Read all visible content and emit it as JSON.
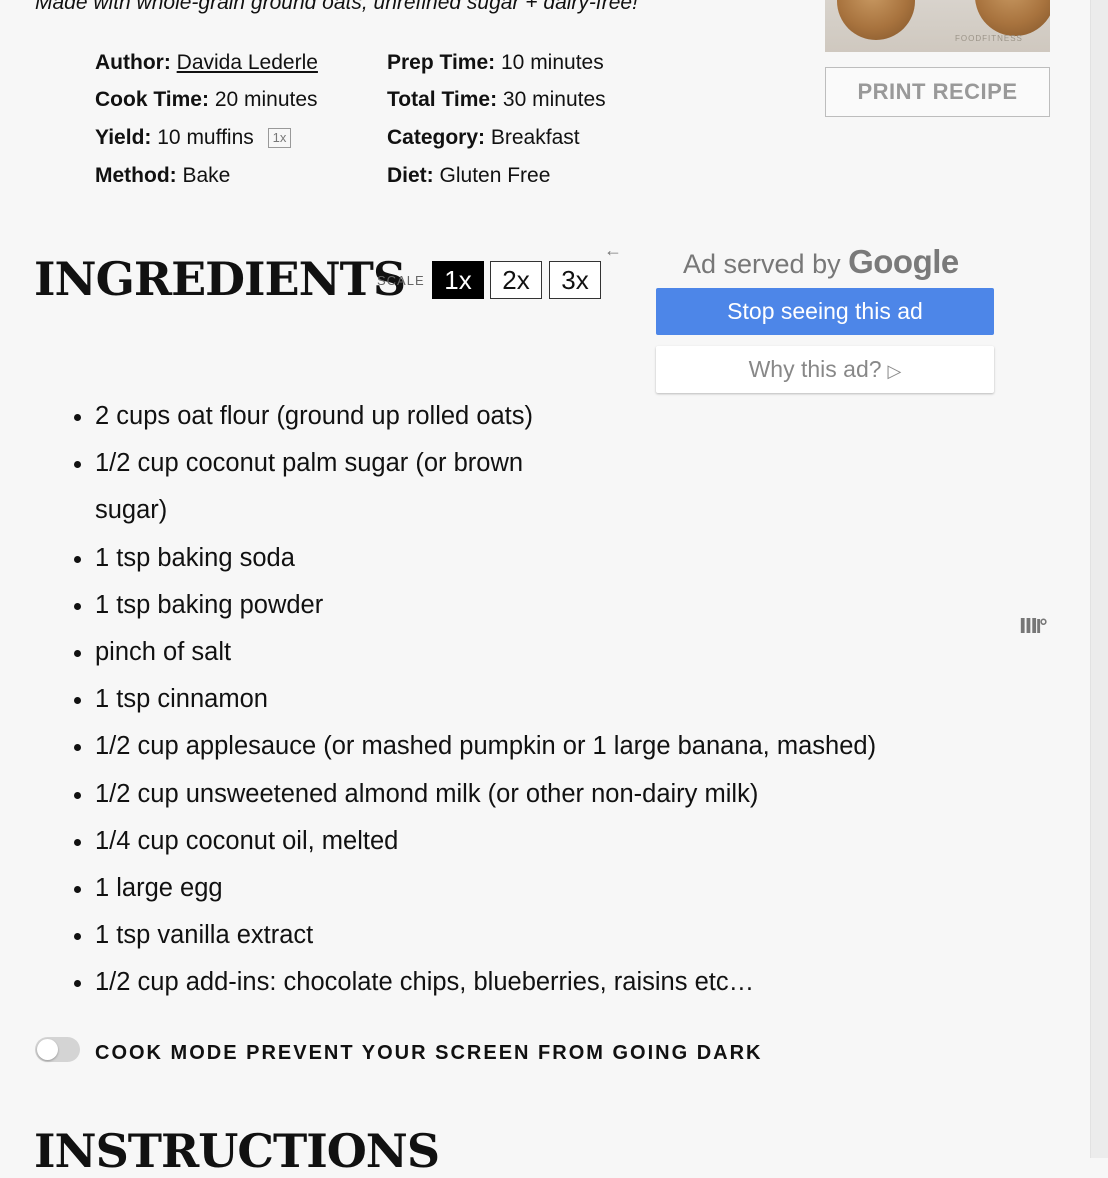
{
  "recipe": {
    "description": "Made with whole-grain ground oats, unrefined sugar + dairy-free!",
    "meta": {
      "author_label": "Author:",
      "author_value": "Davida Lederle",
      "prep_label": "Prep Time:",
      "prep_value": "10 minutes",
      "cook_label": "Cook Time:",
      "cook_value": "20 minutes",
      "total_label": "Total Time:",
      "total_value": "30 minutes",
      "yield_label": "Yield:",
      "yield_value": "10 muffins",
      "yield_scale": "1x",
      "category_label": "Category:",
      "category_value": "Breakfast",
      "method_label": "Method:",
      "method_value": "Bake",
      "diet_label": "Diet:",
      "diet_value": "Gluten Free"
    },
    "print_button": "PRINT RECIPE",
    "image_text": "FOODFITNESS"
  },
  "ingredients": {
    "title": "INGREDIENTS",
    "scale_label": "SCALE",
    "scale_options": [
      "1x",
      "2x",
      "3x"
    ],
    "selected_scale": "1x",
    "back_icon": "arrow-left-icon",
    "items": [
      "2 cups oat flour (ground up rolled oats)",
      "1/2 cup coconut palm sugar (or brown sugar)",
      "1 tsp baking soda",
      "1 tsp baking powder",
      "pinch of salt",
      "1 tsp cinnamon",
      "1/2 cup applesauce (or mashed pumpkin or 1 large banana, mashed)",
      "1/2 cup unsweetened almond milk (or other non-dairy milk)",
      "1/4 cup coconut oil, melted",
      "1 large egg",
      "1 tsp vanilla extract",
      "1/2 cup add-ins: chocolate chips, blueberries, raisins etc…"
    ]
  },
  "ad": {
    "served_by": "Ad served by",
    "google": "Google",
    "stop_button": "Stop seeing this ad",
    "why_button": "Why this ad?",
    "logo_text": "ⅢI°"
  },
  "cook_mode": {
    "label": "COOK MODE",
    "sublabel": "PREVENT YOUR SCREEN FROM GOING DARK",
    "enabled": false
  },
  "instructions": {
    "title": "INSTRUCTIONS"
  }
}
